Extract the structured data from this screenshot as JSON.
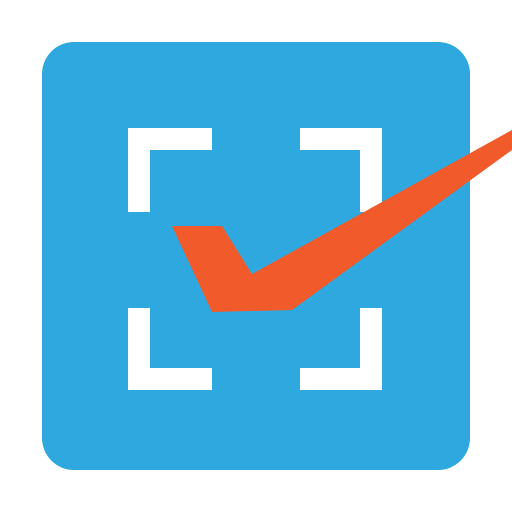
{
  "app_icon": {
    "name": "scan-check-app-icon",
    "colors": {
      "tile": "#2EA8DF",
      "corner": "#FFFFFF",
      "checkmark": "#F15A2B",
      "page_background": "#FFFFFF"
    },
    "glyphs": {
      "frame": "scan-frame-corners",
      "mark": "checkmark"
    }
  }
}
